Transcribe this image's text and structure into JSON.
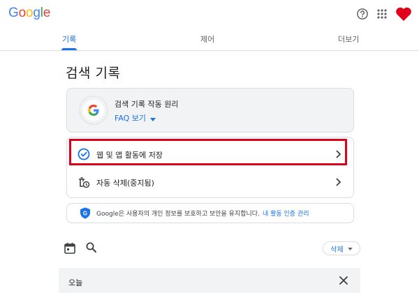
{
  "header": {
    "logo": [
      "G",
      "o",
      "o",
      "g",
      "l",
      "e"
    ],
    "icons": [
      "help-icon",
      "apps-grid-icon",
      "avatar-heart"
    ],
    "colors": {
      "blue": "#4285F4",
      "red": "#EA4335",
      "yellow": "#FBBC05",
      "green": "#34A853"
    }
  },
  "tabs": [
    {
      "label": "기록",
      "active": true
    },
    {
      "label": "제어",
      "active": false
    },
    {
      "label": "더보기",
      "active": false
    }
  ],
  "page": {
    "title": "검색 기록"
  },
  "info_card": {
    "title": "검색 기록 작동 원리",
    "faq_label": "FAQ 보기"
  },
  "settings": [
    {
      "label": "웹 및 앱 활동에 저장",
      "icon": "check-circle-icon",
      "highlighted": true
    },
    {
      "label": "자동 삭제(중지됨)",
      "icon": "auto-delete-icon",
      "highlighted": false
    }
  ],
  "privacy": {
    "text": "Google은 사용자의 개인 정보를 보호하고 보안을 유지합니다.",
    "link": "내 활동 인증 관리"
  },
  "toolbar": {
    "delete_label": "삭제",
    "icons": [
      "calendar-icon",
      "search-icon"
    ]
  },
  "today": {
    "label": "오늘"
  },
  "accent": "#1a73e8",
  "highlight_color": "#e0001a"
}
